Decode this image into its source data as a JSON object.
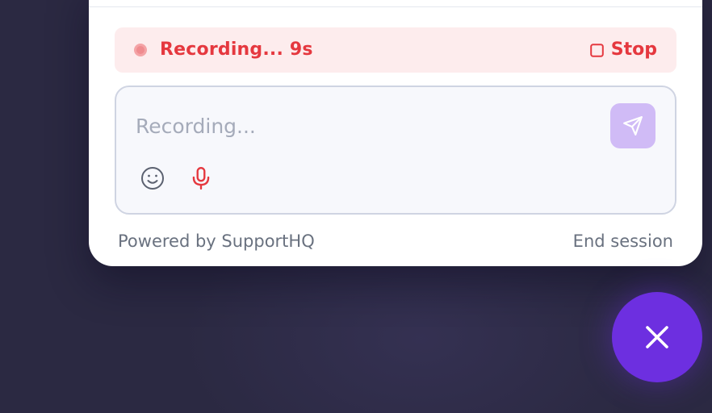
{
  "recording_banner": {
    "status_text": "Recording... 9s",
    "stop_label": "Stop",
    "color": "#e5383f",
    "background": "#fdeced"
  },
  "composer": {
    "placeholder": "Recording...",
    "value": ""
  },
  "icons": {
    "recording_indicator": "recording-dot-icon",
    "stop": "square-stop-icon",
    "send": "paper-plane-icon",
    "emoji": "smiley-icon",
    "microphone": "microphone-icon",
    "close": "close-x-icon"
  },
  "footer": {
    "powered_by": "Powered by SupportHQ",
    "end_session": "End session"
  },
  "colors": {
    "accent": "#6d2fe0",
    "send_button_disabled": "#d0bbf6",
    "mic_active": "#e5383f",
    "muted_text": "#69717f",
    "page_background": "#2b2942"
  }
}
